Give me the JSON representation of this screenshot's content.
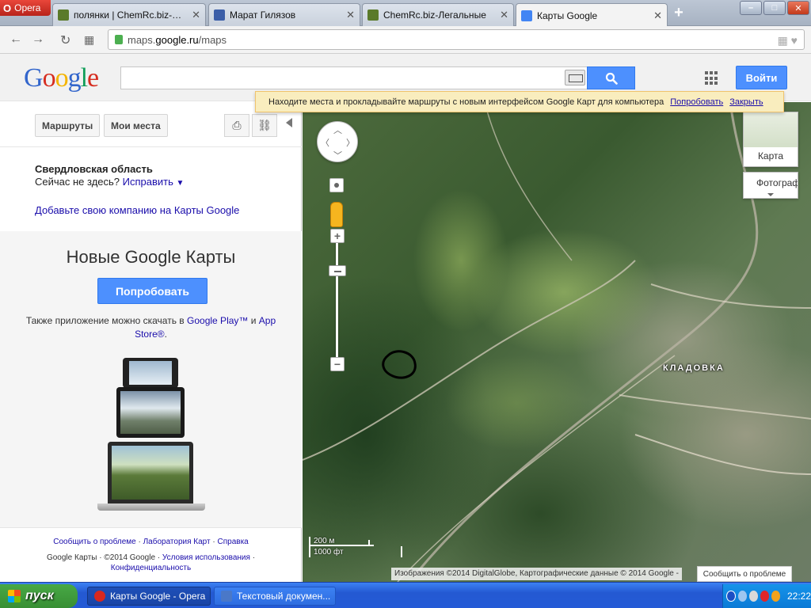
{
  "browser": {
    "menu_label": "Opera",
    "tabs": [
      {
        "title": "полянки | ChemRc.biz-Легальные",
        "icon": "chemrc-favicon-icon",
        "color": "#5a7a2a",
        "active": false
      },
      {
        "title": "Марат Гилязов",
        "icon": "media-favicon-icon",
        "color": "#3b5ea8",
        "active": false
      },
      {
        "title": "ChemRc.biz-Легальные",
        "icon": "chemrc-favicon-icon",
        "color": "#5a7a2a",
        "active": false
      },
      {
        "title": "Карты Google",
        "icon": "google-maps-favicon-icon",
        "color": "#4285f4",
        "active": true
      }
    ],
    "url": {
      "prefix": "maps.",
      "domain": "google.ru",
      "path": "/maps"
    }
  },
  "header": {
    "logo_letters": [
      "G",
      "o",
      "o",
      "g",
      "l",
      "e"
    ],
    "search_value": "",
    "signin_label": "Войти"
  },
  "notice": {
    "text": "Находите места и прокладывайте маршруты с новым интерфейсом Google Карт для компьютера",
    "try_link": "Попробовать",
    "close_link": "Закрыть"
  },
  "left_panel": {
    "routes_label": "Маршруты",
    "my_places_label": "Мои места",
    "region": "Свердловская область",
    "not_here": "Сейчас не здесь?",
    "fix_link": "Исправить",
    "add_business": "Добавьте свою компанию на Карты Google",
    "promo": {
      "title": "Новые Google Карты",
      "button": "Попробовать",
      "text_before": "Также приложение можно скачать в",
      "google_play": "Google Play™",
      "and": "и",
      "app_store": "App Store®",
      "period": "."
    },
    "footer": {
      "report": "Сообщить о проблеме",
      "labs": "Лаборатория Карт",
      "help": "Справка",
      "brand": "Google Карты",
      "copyright": "©2014 Google",
      "terms": "Условия использования",
      "privacy": "Конфиденциальность"
    }
  },
  "map": {
    "map_type_label": "Карта",
    "satellite_label": "Фотографии",
    "place_label": "КЛАДОВКА",
    "scale_metric": "200 м",
    "scale_imperial": "1000 фт",
    "attribution": "Изображения ©2014 DigitalGlobe, Картографические данные © 2014 Google -",
    "report_button": "Сообщить о проблеме"
  },
  "taskbar": {
    "start_label": "пуск",
    "items": [
      {
        "title": "Карты Google - Opera",
        "color": "#d8281f"
      },
      {
        "title": "Текстовый докумен...",
        "color": "#4a78c8"
      }
    ],
    "clock": "22:22"
  }
}
